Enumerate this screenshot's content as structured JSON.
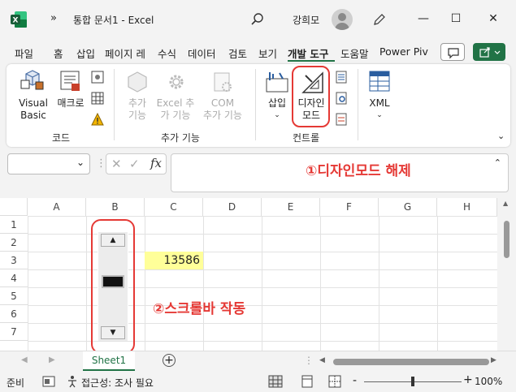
{
  "titlebar": {
    "more": "»",
    "doc_title": "통합 문서1  -  Excel",
    "user_name": "강희모",
    "minimize": "—",
    "maximize": "☐",
    "close": "✕"
  },
  "tabs": [
    "파일",
    "홈",
    "삽입",
    "페이지 레",
    "수식",
    "데이터",
    "검토",
    "보기",
    "개발 도구",
    "도움말",
    "Power Piv"
  ],
  "active_tab": "개발 도구",
  "ribbon": {
    "code": {
      "label": "코드",
      "visual_basic": "Visual\nBasic",
      "macro": "매크로"
    },
    "addins": {
      "label": "추가 기능",
      "addin": "추가\n기능",
      "excel_addin": "Excel 추\n가 기능",
      "com_addin": "COM\n추가 기능"
    },
    "controls": {
      "label": "컨트롤",
      "insert": "삽입",
      "design_mode": "디자인\n모드"
    },
    "xml": {
      "label": "XML"
    }
  },
  "formula_bar": {
    "fx": "fx",
    "cancel": "✕",
    "enter": "✓"
  },
  "annotations": {
    "note1": "①디자인모드 해제",
    "note2": "②스크롤바 작동"
  },
  "grid": {
    "columns": [
      "A",
      "B",
      "C",
      "D",
      "E",
      "F",
      "G",
      "H"
    ],
    "rows": [
      "1",
      "2",
      "3",
      "4",
      "5",
      "6",
      "7"
    ],
    "c3_value": "13586"
  },
  "sheet": {
    "name": "Sheet1",
    "add": "+"
  },
  "status": {
    "ready": "준비",
    "accessibility": "접근성: 조사 필요",
    "zoom": "100%",
    "minus": "-",
    "plus": "+"
  },
  "colors": {
    "accent": "#217346",
    "highlight": "#e53935",
    "cell_fill": "#ffff99"
  }
}
